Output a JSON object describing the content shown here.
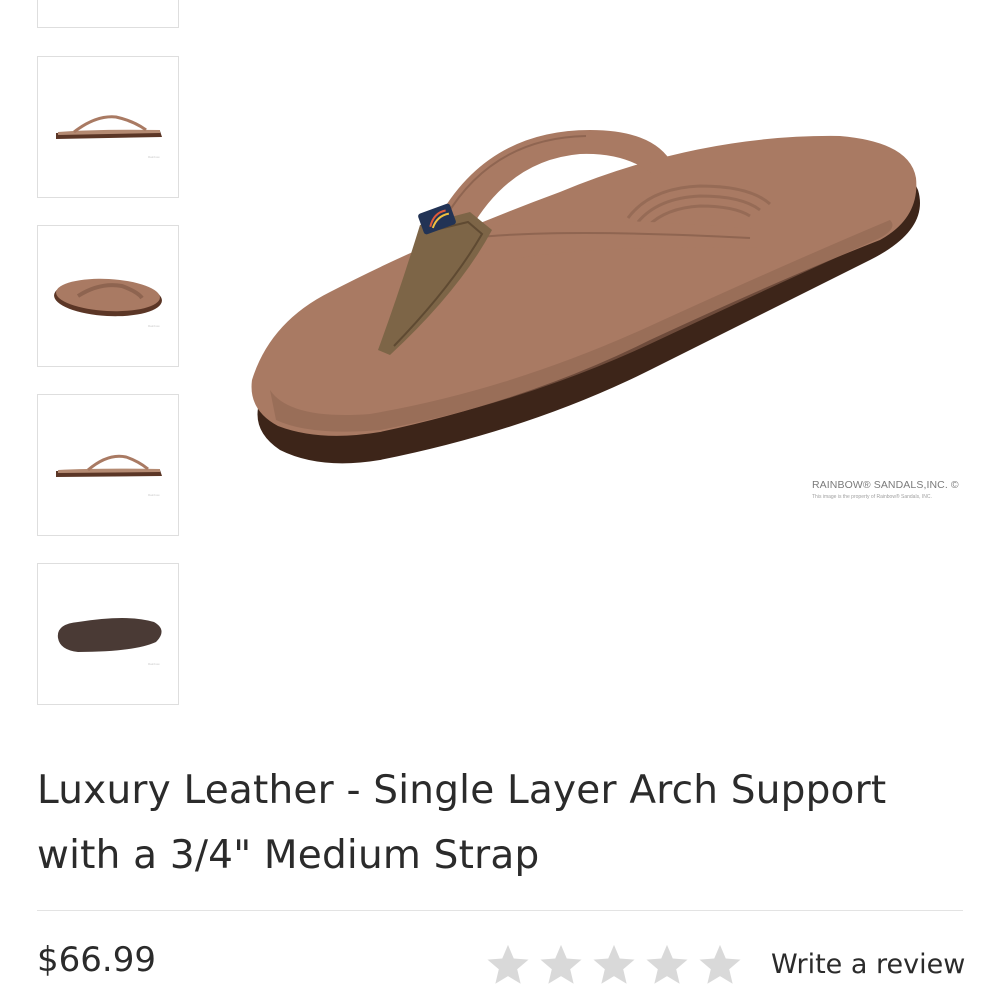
{
  "gallery": {
    "thumbnails": [
      {
        "icon": "sandal-partial-view-icon",
        "selected": false
      },
      {
        "icon": "sandal-side-view-icon",
        "selected": false
      },
      {
        "icon": "sandal-angled-view-icon",
        "selected": false
      },
      {
        "icon": "sandal-side-view-icon",
        "selected": false
      },
      {
        "icon": "sandal-sole-view-icon",
        "selected": false
      }
    ],
    "main_image": {
      "icon": "sandal-main-image",
      "watermark": "RAINBOW® SANDALS,INC. ©",
      "watermark_sub": "This image is the property of Rainbow® Sandals, INC."
    }
  },
  "product": {
    "title_line1": "Luxury Leather - Single Layer Arch Support",
    "title_line2": "with a 3/4\" Medium Strap",
    "price": "$66.99",
    "rating": {
      "stars_filled": 0,
      "stars_total": 5,
      "star_color": "#d9d9d9"
    },
    "write_review_label": "Write a review"
  },
  "colors": {
    "leather": "#a97a63",
    "sole_dark": "#4a2d1f",
    "text": "#2b2b2b"
  }
}
